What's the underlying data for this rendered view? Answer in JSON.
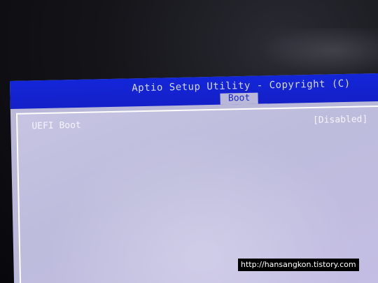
{
  "header": {
    "title": "Aptio Setup Utility - Copyright (C)",
    "active_tab": "Boot"
  },
  "settings": [
    {
      "label": "UEFI Boot",
      "value": "[Disabled]"
    }
  ],
  "watermark": "http://hansangkon.tistory.com",
  "colors": {
    "title_bar": "#1420c8",
    "panel_bg": "#bdbcdc",
    "text": "#f4f4ff"
  }
}
